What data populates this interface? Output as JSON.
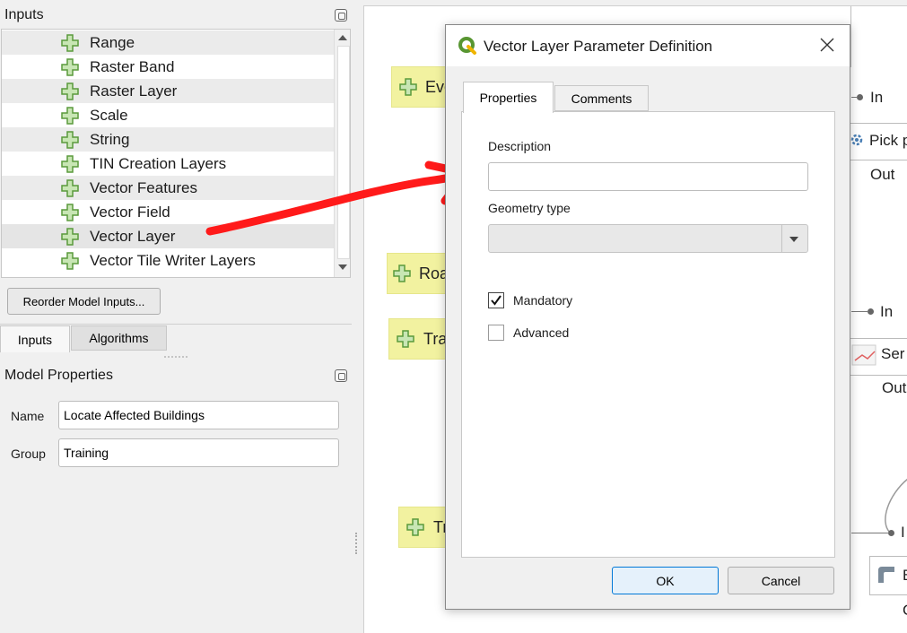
{
  "inputs_panel": {
    "title": "Inputs",
    "items": [
      {
        "label": "Range"
      },
      {
        "label": "Raster Band"
      },
      {
        "label": "Raster Layer"
      },
      {
        "label": "Scale"
      },
      {
        "label": "String"
      },
      {
        "label": "TIN Creation Layers"
      },
      {
        "label": "Vector Features"
      },
      {
        "label": "Vector Field"
      },
      {
        "label": "Vector Layer"
      },
      {
        "label": "Vector Tile Writer Layers"
      }
    ],
    "reorder_button": "Reorder Model Inputs...",
    "tabs": [
      "Inputs",
      "Algorithms"
    ]
  },
  "model_properties": {
    "title": "Model Properties",
    "name_label": "Name",
    "name_value": "Locate Affected Buildings",
    "group_label": "Group",
    "group_value": "Training"
  },
  "canvas": {
    "nodes": [
      "Eve",
      "Roa",
      "Tra",
      "Tr"
    ],
    "algorithms": [
      "Pick p",
      "Ser",
      "B"
    ],
    "port_in": "In",
    "port_out": "Out",
    "port_out_short": "Out",
    "port_i": "I",
    "port_c": "C"
  },
  "dialog": {
    "title": "Vector Layer Parameter Definition",
    "tabs": [
      "Properties",
      "Comments"
    ],
    "description_label": "Description",
    "description_value": "",
    "geometry_label": "Geometry type",
    "geometry_value": "",
    "mandatory_label": "Mandatory",
    "mandatory_checked": true,
    "advanced_label": "Advanced",
    "advanced_checked": false,
    "ok_label": "OK",
    "cancel_label": "Cancel"
  },
  "colors": {
    "node_fill": "#f2f2a0",
    "annotation_arrow": "#ff0000",
    "plus_icon": "#6aa84f",
    "qgis_green": "#589632"
  }
}
